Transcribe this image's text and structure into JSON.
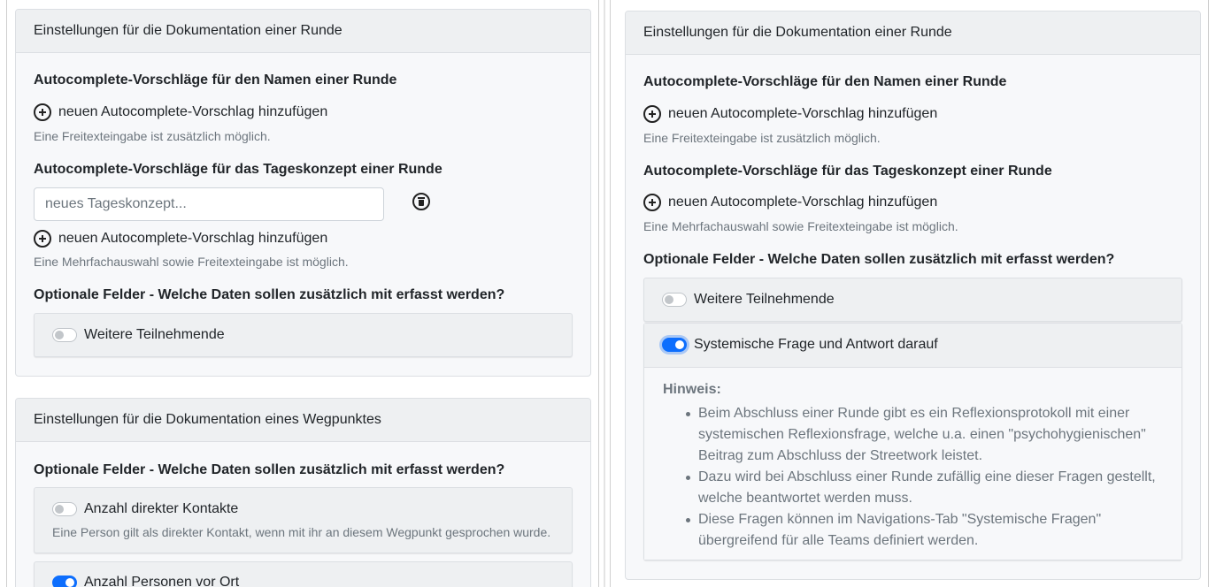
{
  "left": {
    "round_card": {
      "header": "Einstellungen für die Dokumentation einer Runde",
      "name_title": "Autocomplete-Vorschläge für den Namen einer Runde",
      "name_add": "neuen Autocomplete-Vorschlag hinzufügen",
      "name_help": "Eine Freitexteingabe ist zusätzlich möglich.",
      "concept_title": "Autocomplete-Vorschläge für das Tageskonzept einer Runde",
      "concept_placeholder": "neues Tageskonzept...",
      "concept_add": "neuen Autocomplete-Vorschlag hinzufügen",
      "concept_help": "Eine Mehrfachauswahl sowie Freitexteingabe ist möglich.",
      "optional_title": "Optionale Felder - Welche Daten sollen zusätzlich mit erfasst werden?",
      "opt_participants": {
        "label": "Weitere Teilnehmende",
        "on": false
      }
    },
    "waypoint_card": {
      "header": "Einstellungen für die Dokumentation eines Wegpunktes",
      "optional_title": "Optionale Felder - Welche Daten sollen zusätzlich mit erfasst werden?",
      "opt_direct_contacts": {
        "label": "Anzahl direkter Kontakte",
        "on": false,
        "help": "Eine Person gilt als direkter Kontakt, wenn mit ihr an diesem Wegpunkt gesprochen wurde."
      },
      "opt_persons_on_site": {
        "label": "Anzahl Personen vor Ort",
        "on": true
      }
    }
  },
  "right": {
    "round_card": {
      "header": "Einstellungen für die Dokumentation einer Runde",
      "name_title": "Autocomplete-Vorschläge für den Namen einer Runde",
      "name_add": "neuen Autocomplete-Vorschlag hinzufügen",
      "name_help": "Eine Freitexteingabe ist zusätzlich möglich.",
      "concept_title": "Autocomplete-Vorschläge für das Tageskonzept einer Runde",
      "concept_add": "neuen Autocomplete-Vorschlag hinzufügen",
      "concept_help": "Eine Mehrfachauswahl sowie Freitexteingabe ist möglich.",
      "optional_title": "Optionale Felder - Welche Daten sollen zusätzlich mit erfasst werden?",
      "opt_participants": {
        "label": "Weitere Teilnehmende",
        "on": false
      },
      "opt_systemic": {
        "label": "Systemische Frage und Antwort darauf",
        "on": true
      },
      "hint": {
        "title": "Hinweis:",
        "items": [
          "Beim Abschluss einer Runde gibt es ein Reflexionsprotokoll mit einer systemischen Reflexionsfrage, welche u.a. einen \"psychohygienischen\" Beitrag zum Abschluss der Streetwork leistet.",
          "Dazu wird bei Abschluss einer Runde zufällig eine dieser Fragen gestellt, welche beantwortet werden muss.",
          "Diese Fragen können im Navigations-Tab \"Systemische Fragen\" übergreifend für alle Teams definiert werden."
        ]
      }
    }
  },
  "colors": {
    "accent": "#0d6efd",
    "muted": "#6c757d",
    "card_bg": "#f7f8fa",
    "header_bg": "#eef0f2"
  }
}
